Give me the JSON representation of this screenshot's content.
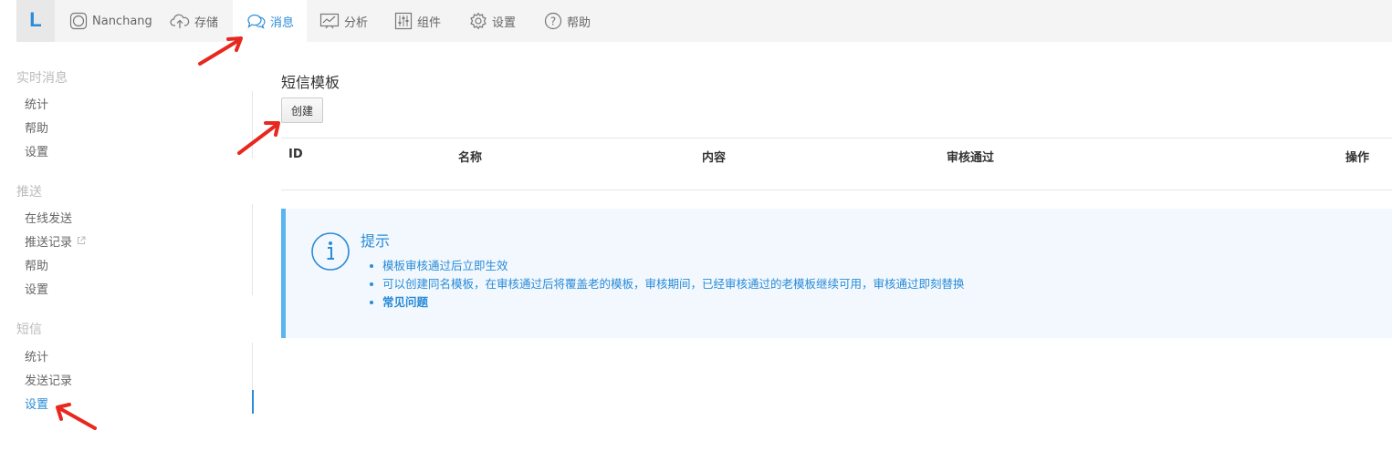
{
  "header": {
    "logo": "L",
    "nav": [
      {
        "label": "Nanchang",
        "icon": "app-circle-icon"
      },
      {
        "label": "存储",
        "icon": "cloud-upload-icon"
      },
      {
        "label": "消息",
        "icon": "chat-bubbles-icon",
        "active": true
      },
      {
        "label": "分析",
        "icon": "chart-icon"
      },
      {
        "label": "组件",
        "icon": "sliders-icon"
      },
      {
        "label": "设置",
        "icon": "gear-icon"
      },
      {
        "label": "帮助",
        "icon": "help-icon"
      }
    ]
  },
  "sidebar": {
    "groups": [
      {
        "title": "实时消息",
        "items": [
          "统计",
          "帮助",
          "设置"
        ]
      },
      {
        "title": "推送",
        "items": [
          "在线发送",
          "推送记录",
          "帮助",
          "设置"
        ]
      },
      {
        "title": "短信",
        "items": [
          "统计",
          "发送记录",
          "设置"
        ]
      }
    ],
    "active_item": "短信 > 设置"
  },
  "main": {
    "title": "短信模板",
    "create_label": "创建",
    "table": {
      "columns": [
        "ID",
        "名称",
        "内容",
        "审核通过",
        "操作"
      ],
      "rows": []
    },
    "alert": {
      "title": "提示",
      "items": [
        "模板审核通过后立即生效",
        "可以创建同名模板，在审核通过后将覆盖老的模板，审核期间，已经审核通过的老模板继续可用，审核通过即刻替换",
        "常见问题"
      ]
    }
  },
  "colors": {
    "accent": "#2a8bd8",
    "alert_border": "#5ab4f0",
    "alert_bg": "#f2f8fd",
    "annotation_arrow": "#e8281e"
  }
}
